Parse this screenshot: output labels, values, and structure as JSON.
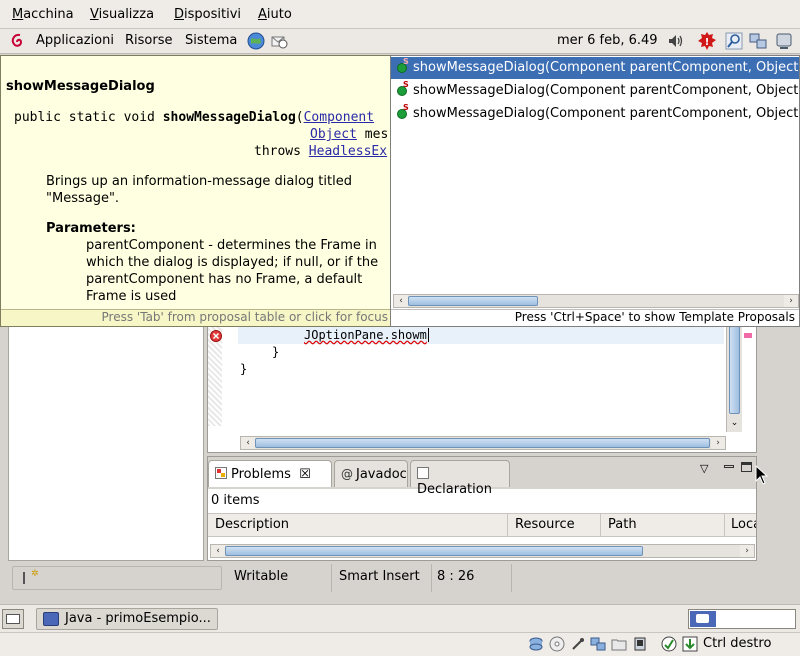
{
  "vbox_menu": {
    "items": [
      {
        "label": "Macchina",
        "u": "M",
        "rest": "acchina"
      },
      {
        "label": "Visualizza",
        "u": "V",
        "rest": "isualizza"
      },
      {
        "label": "Dispositivi",
        "u": "D",
        "rest": "ispositivi"
      },
      {
        "label": "Aiuto",
        "u": "A",
        "rest": "iuto"
      }
    ]
  },
  "gnome_top": {
    "applications": "Applicazioni",
    "places": "Risorse",
    "system": "Sistema",
    "clock": "mer  6 feb,  6.49"
  },
  "javadoc": {
    "title": "showMessageDialog",
    "sig_prefix": "public static void ",
    "sig_method": "showMessageDialog",
    "sig_paren": "(",
    "param1_type": "Component",
    "param2_type": "Object",
    "param2_rest": " mes",
    "throws": "throws ",
    "exception": "HeadlessEx",
    "description_line1": "Brings up an information-message dialog titled",
    "description_line2": "\"Message\".",
    "params_heading": "Parameters:",
    "param_lines": [
      "parentComponent - determines the Frame in",
      "which the dialog is displayed; if null, or if the",
      "parentComponent has no Frame, a default",
      "Frame is used"
    ],
    "hint": "Press 'Tab' from proposal table or click for focus"
  },
  "proposals": {
    "items": [
      {
        "text": "showMessageDialog(Component parentComponent, Object m"
      },
      {
        "text": "showMessageDialog(Component parentComponent, Object m"
      },
      {
        "text": "showMessageDialog(Component parentComponent, Object m"
      }
    ],
    "hint": "Press 'Ctrl+Space' to show Template Proposals"
  },
  "editor": {
    "lines": [
      "JOptionPane.showm",
      "}",
      "}"
    ]
  },
  "problems_view": {
    "tabs": [
      {
        "label": "Problems",
        "icon": "problems-icon"
      },
      {
        "label": "Javadoc",
        "icon": "at-icon"
      },
      {
        "label": "Declaration",
        "icon": "declaration-icon"
      }
    ],
    "count": "0 items",
    "columns": [
      "Description",
      "Resource",
      "Path",
      "Loca"
    ]
  },
  "statusbar": {
    "writable": "Writable",
    "insert_mode": "Smart Insert",
    "position": "8 : 26"
  },
  "taskbar": {
    "window_title": "Java - primoEsempio..."
  },
  "vbox_status": {
    "host_key": "Ctrl destro"
  }
}
